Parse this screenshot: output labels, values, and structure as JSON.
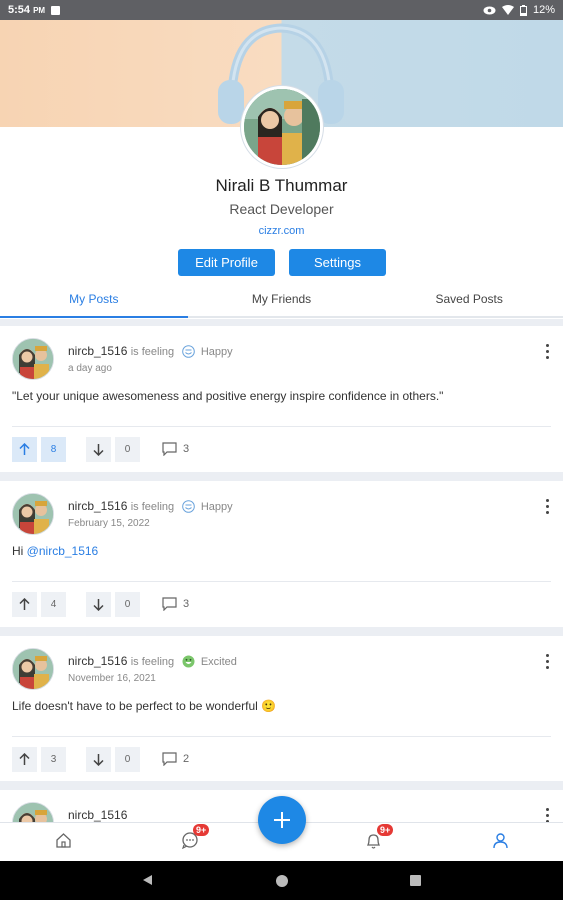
{
  "status_bar": {
    "time": "5:54",
    "time_suffix": "PM",
    "battery": "12%"
  },
  "profile": {
    "name": "Nirali B Thummar",
    "role": "React Developer",
    "website": "cizzr.com",
    "edit_label": "Edit Profile",
    "settings_label": "Settings"
  },
  "tabs": [
    {
      "label": "My Posts",
      "active": true
    },
    {
      "label": "My Friends",
      "active": false
    },
    {
      "label": "Saved Posts",
      "active": false
    }
  ],
  "posts": [
    {
      "user": "nircb_1516",
      "feeling_label": "is feeling",
      "mood": "Happy",
      "date": "a day ago",
      "text": "\"Let your unique awesomeness and positive energy inspire confidence in others.\"",
      "upvotes": "8",
      "downvotes": "0",
      "comments": "3"
    },
    {
      "user": "nircb_1516",
      "feeling_label": "is feeling",
      "mood": "Happy",
      "date": "February 15, 2022",
      "text_prefix": "Hi ",
      "mention": "@nircb_1516",
      "upvotes": "4",
      "downvotes": "0",
      "comments": "3"
    },
    {
      "user": "nircb_1516",
      "feeling_label": "is feeling",
      "mood": "Excited",
      "date": "November 16, 2021",
      "text": "Life doesn't have to be perfect to be wonderful 🙂",
      "upvotes": "3",
      "downvotes": "0",
      "comments": "2"
    },
    {
      "user": "nircb_1516"
    }
  ],
  "bottom_nav": {
    "messages_badge": "9+",
    "notifications_badge": "9+"
  },
  "colors": {
    "primary": "#1e88e5",
    "link": "#2a7ee3",
    "badge": "#e53935",
    "background": "#ebeef3"
  },
  "icons": [
    "home-icon",
    "chat-icon",
    "add-icon",
    "bell-icon",
    "user-icon",
    "upvote-icon",
    "downvote-icon",
    "comment-icon",
    "more-vert-icon",
    "happy-mood-icon",
    "excited-mood-icon",
    "headphones-icon"
  ]
}
